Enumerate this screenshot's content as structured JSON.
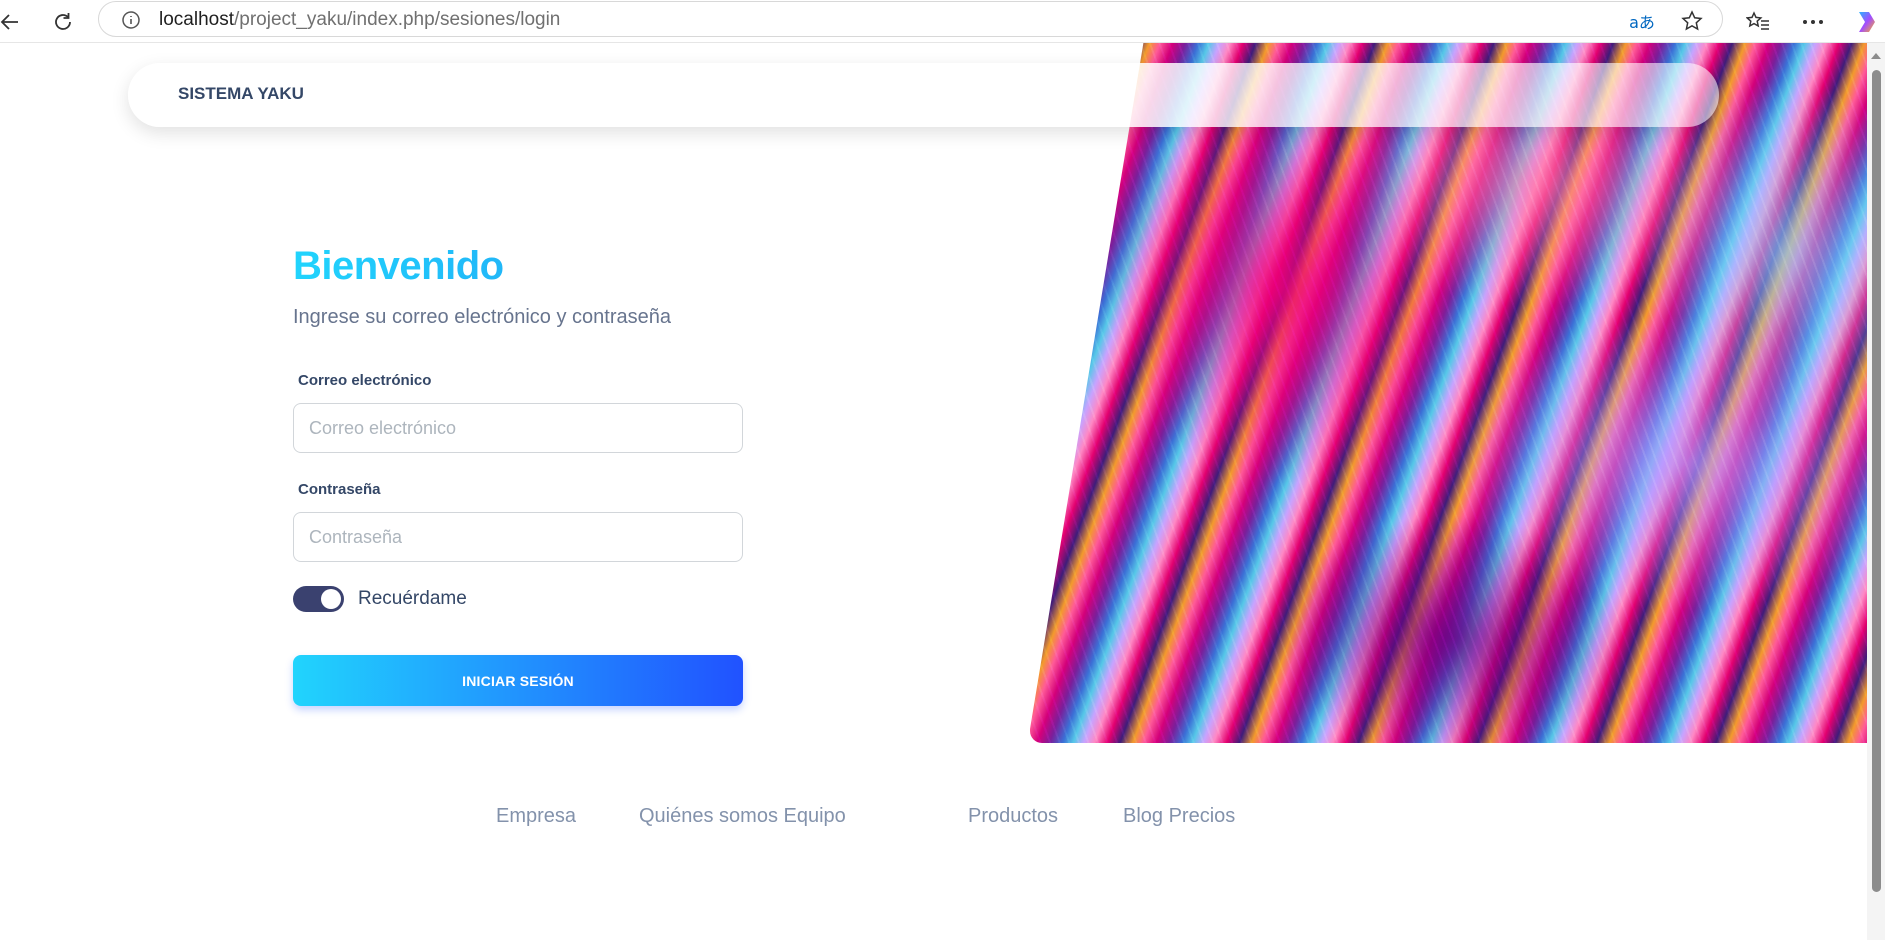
{
  "browser": {
    "url_host": "localhost",
    "url_path": "/project_yaku/index.php/sesiones/login",
    "translate_label": "aあ"
  },
  "navbar": {
    "brand": "SISTEMA YAKU"
  },
  "login": {
    "title": "Bienvenido",
    "subtitle": "Ingrese su correo electrónico y contraseña",
    "email_label": "Correo electrónico",
    "email_placeholder": "Correo electrónico",
    "email_value": "",
    "password_label": "Contraseña",
    "password_placeholder": "Contraseña",
    "password_value": "",
    "remember_label": "Recuérdame",
    "remember_checked": true,
    "submit_label": "INICIAR SESIÓN"
  },
  "footer": {
    "links": [
      "Empresa",
      "Quiénes somos Equipo",
      "Productos",
      "Blog Precios"
    ]
  },
  "colors": {
    "accent_gradient_start": "#21d4fd",
    "accent_gradient_end": "#2152ff",
    "toggle_on": "#3a416f",
    "heading_text": "#344767",
    "muted_text": "#8392ab"
  }
}
